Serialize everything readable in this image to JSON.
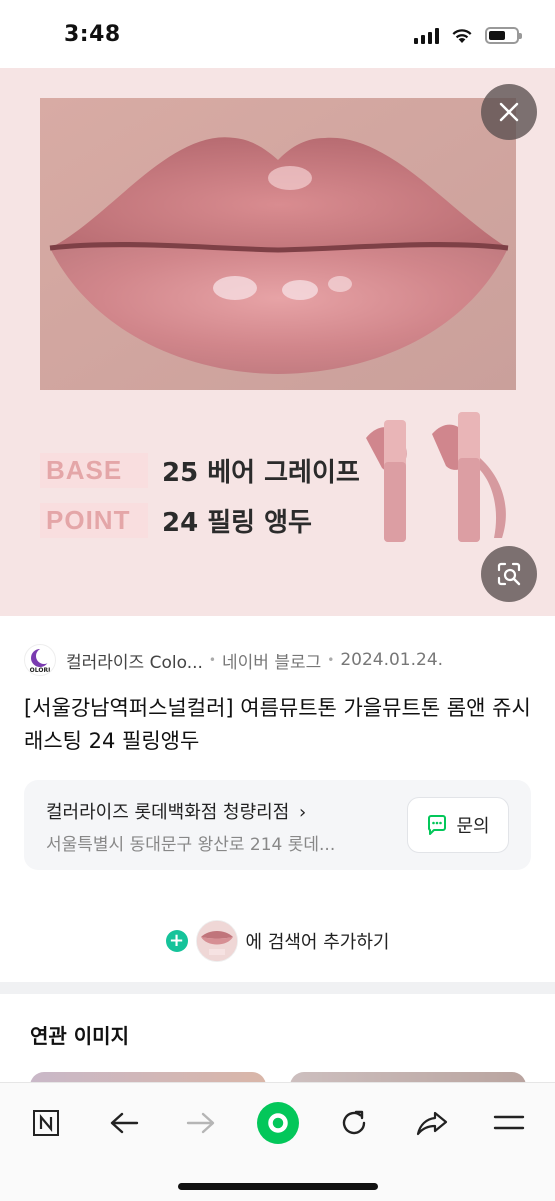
{
  "status_bar": {
    "time": "3:48"
  },
  "product": {
    "rows": [
      {
        "tag": "BASE",
        "name": "25 베어 그레이프"
      },
      {
        "tag": "POINT",
        "name": "24 필링 앵두"
      }
    ]
  },
  "source": {
    "name": "컬러라이즈 Colo...",
    "site": "네이버 블로그",
    "date": "2024.01.24."
  },
  "post_title": "[서울강남역퍼스널컬러] 여름뮤트톤 가을뮤트톤 롬앤 쥬시래스팅 24 필링앵두",
  "store": {
    "name": "컬러라이즈 롯데백화점 청량리점",
    "chevron": "›",
    "address": "서울특별시 동대문구 왕산로 214 롯데...",
    "inquiry_label": "문의"
  },
  "add_search": {
    "label": "에 검색어 추가하기"
  },
  "related": {
    "title": "연관 이미지"
  },
  "icons": {
    "close": "close-icon",
    "lens": "lens-search-icon",
    "inquiry": "chat-icon",
    "toolbar": [
      "naver-n-icon",
      "back-arrow-icon",
      "forward-arrow-icon",
      "home-circle-icon",
      "refresh-icon",
      "share-icon",
      "menu-icon"
    ]
  },
  "colors": {
    "accent_green": "#03c75a",
    "plus_green": "#15c39a",
    "tag_pink": "#e4a6a8"
  }
}
